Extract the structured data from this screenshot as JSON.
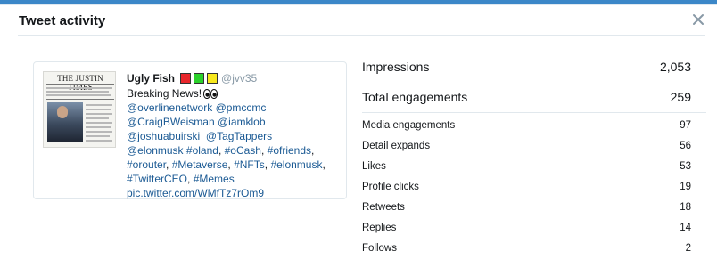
{
  "dialog": {
    "title": "Tweet activity",
    "close_icon": "close-icon"
  },
  "colors": {
    "accent_bar": "#3b87c8",
    "link": "#1b5a94",
    "handle": "#8899a6",
    "square_red": "#e8262b",
    "square_green": "#2bd12b",
    "square_yellow": "#f7e81c"
  },
  "tweet": {
    "thumbnail_title": "THE JUSTIN TIMES",
    "author_name": "Ugly Fish",
    "author_squares": [
      "red",
      "green",
      "yellow"
    ],
    "handle": "@jvv35",
    "line1": "Breaking News!",
    "line1_emoji": "eyes-emoji",
    "mentions1": [
      "@overlinenetwork",
      "@pmccmc"
    ],
    "mentions2": [
      "@CraigBWeisman",
      "@iamklob"
    ],
    "mentions3": [
      "@joshuabuirski",
      "@TagTappers"
    ],
    "line5": [
      "@elonmusk",
      "#oland",
      "#oCash",
      "#ofriends"
    ],
    "line6": [
      "#orouter",
      "#Metaverse",
      "#NFTs",
      "#elonmusk"
    ],
    "line7": [
      "#TwitterCEO",
      "#Memes"
    ],
    "media_link": "pic.twitter.com/WMfTz7rOm9"
  },
  "metrics": {
    "impressions": {
      "label": "Impressions",
      "value": "2,053"
    },
    "total_engagements": {
      "label": "Total engagements",
      "value": "259"
    },
    "rows": [
      {
        "label": "Media engagements",
        "value": "97"
      },
      {
        "label": "Detail expands",
        "value": "56"
      },
      {
        "label": "Likes",
        "value": "53"
      },
      {
        "label": "Profile clicks",
        "value": "19"
      },
      {
        "label": "Retweets",
        "value": "18"
      },
      {
        "label": "Replies",
        "value": "14"
      },
      {
        "label": "Follows",
        "value": "2"
      }
    ]
  }
}
